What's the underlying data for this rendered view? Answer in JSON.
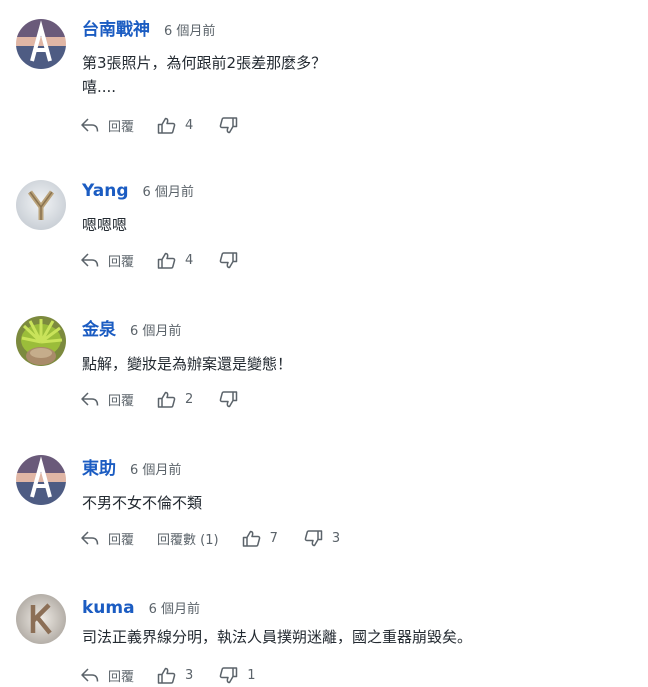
{
  "comments": [
    {
      "author": "台南戰神",
      "time": "6 個月前",
      "lines": [
        "第3張照片，為何跟前2張差那麼多？",
        "嘻...."
      ],
      "reply_label": "回覆",
      "likes": "4",
      "avatar": "letter-a"
    },
    {
      "author": "Yang",
      "time": "6 個月前",
      "lines": [
        "嗯嗯嗯"
      ],
      "reply_label": "回覆",
      "likes": "4",
      "avatar": "letter-y"
    },
    {
      "author": "金泉",
      "time": "6 個月前",
      "lines": [
        "點解，變妝是為辦案還是變態！"
      ],
      "reply_label": "回覆",
      "likes": "2",
      "avatar": "plant-photo"
    },
    {
      "author": "東助",
      "time": "6 個月前",
      "lines": [
        "不男不女不倫不類"
      ],
      "reply_label": "回覆",
      "replies_label": "回覆數 (1)",
      "likes": "7",
      "dislikes": "3",
      "avatar": "letter-a"
    },
    {
      "author": "kuma",
      "time": "6 個月前",
      "lines": [
        "司法正義界線分明，執法人員撲朔迷離，國之重器崩毀矣。"
      ],
      "reply_label": "回覆",
      "likes": "3",
      "dislikes": "1",
      "avatar": "letter-k"
    }
  ],
  "colors": {
    "author": "#1b5cc2",
    "meta": "#5b636a",
    "text": "#232a31"
  },
  "icons": {
    "reply": "reply-arrow-icon",
    "like": "thumbs-up-icon",
    "dislike": "thumbs-down-icon"
  }
}
